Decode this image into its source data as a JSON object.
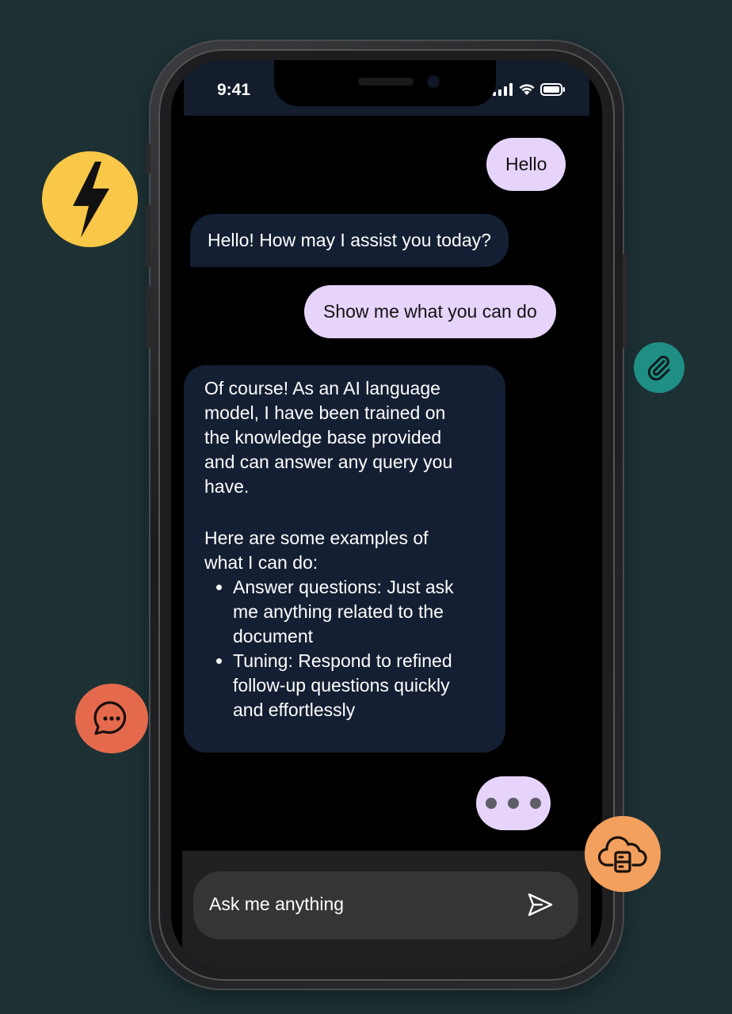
{
  "status": {
    "time": "9:41"
  },
  "chat": {
    "messages": [
      {
        "role": "user",
        "text": "Hello"
      },
      {
        "role": "assistant",
        "text": "Hello! How may I assist you today?"
      },
      {
        "role": "user",
        "text": "Show me what you can do"
      },
      {
        "role": "assistant",
        "paragraph_lines": [
          "Of course! As an AI language",
          "model, I have been trained on",
          "the knowledge base provided",
          "and can answer any query you",
          "have."
        ],
        "intro_lines": [
          "Here are some examples of",
          "what I can do:"
        ],
        "bullets": [
          {
            "lines": [
              "Answer questions: Just ask",
              "me anything related to the",
              "document"
            ]
          },
          {
            "lines": [
              "Tuning: Respond to refined",
              "follow-up questions quickly",
              "and effortlessly"
            ]
          }
        ]
      }
    ]
  },
  "composer": {
    "placeholder": "Ask me anything"
  },
  "icons": {
    "lightning": "lightning-icon",
    "paperclip": "paperclip-icon",
    "chat_bubble": "chat-bubble-icon",
    "cloud_server": "cloud-server-icon",
    "send": "send-icon"
  },
  "colors": {
    "background": "#1d3135",
    "user_bubble": "#e6d4fb",
    "bot_bubble": "#141f33",
    "lightning_badge": "#f9c848",
    "paperclip_badge": "#1f8f84",
    "chat_badge": "#e56a4d",
    "cloud_badge": "#f3a05e"
  }
}
